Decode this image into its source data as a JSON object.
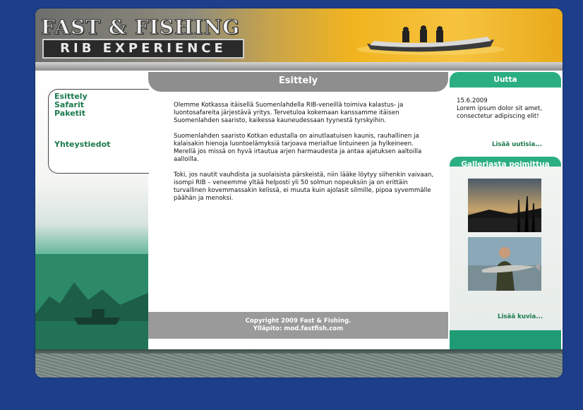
{
  "header": {
    "logo_line1": "FAST & FISHING",
    "logo_line2": "RIB EXPERIENCE"
  },
  "nav": {
    "items": [
      "Esittely",
      "Safarit",
      "Paketit"
    ],
    "contact": "Yhteystiedot"
  },
  "main": {
    "title": "Esittely",
    "paragraphs": [
      "Olemme Kotkassa itäisellä Suomenlahdella RIB-veneillä toimiva kalastus- ja luontosafareita järjestävä yritys. Tervetuloa kokemaan kanssamme itäisen Suomenlahden saaristo, kaikessa kauneudessaan tyynestä tyrskyihin.",
      "Suomenlahden saaristo Kotkan edustalla on ainutlaatuisen kaunis, rauhallinen ja kalaisakin hienoja luontoelämyksiä tarjoava meriallue lintuineen ja hylkeineen. Merellä jos missä on hyvä irtautua arjen harmaudesta ja antaa ajatuksen aaltoilla aalloilla.",
      "Toki, jos nautit vauhdista ja suolaisista pärskeistä, niin lääke löytyy siihenkin vaivaan, isompi RIB – veneemme yltää helposti yli 50 solmun nopeuksiin ja on erittäin turvallinen kovemmassakin kelissä, ei muuta kuin ajolasit silmille, pipoa syvemmälle päähän ja menoksi."
    ]
  },
  "footer": {
    "copyright": "Copyright 2009 Fast & Fishing.",
    "maintainer": "Ylläpito: mod.fastfish.com"
  },
  "news": {
    "title": "Uutta",
    "date": "15.6.2009",
    "text": "Lorem ipsum dolor sit amet, consectetur adipiscing elit!",
    "more": "Lisää uutisia..."
  },
  "gallery": {
    "title": "Galleriasta poimittua",
    "more": "Lisää kuvia..."
  },
  "colors": {
    "background": "#1d3f8a",
    "accent_green": "#2cae83",
    "link_green": "#1b7a4c",
    "gray_bar": "#8e8e8e"
  }
}
